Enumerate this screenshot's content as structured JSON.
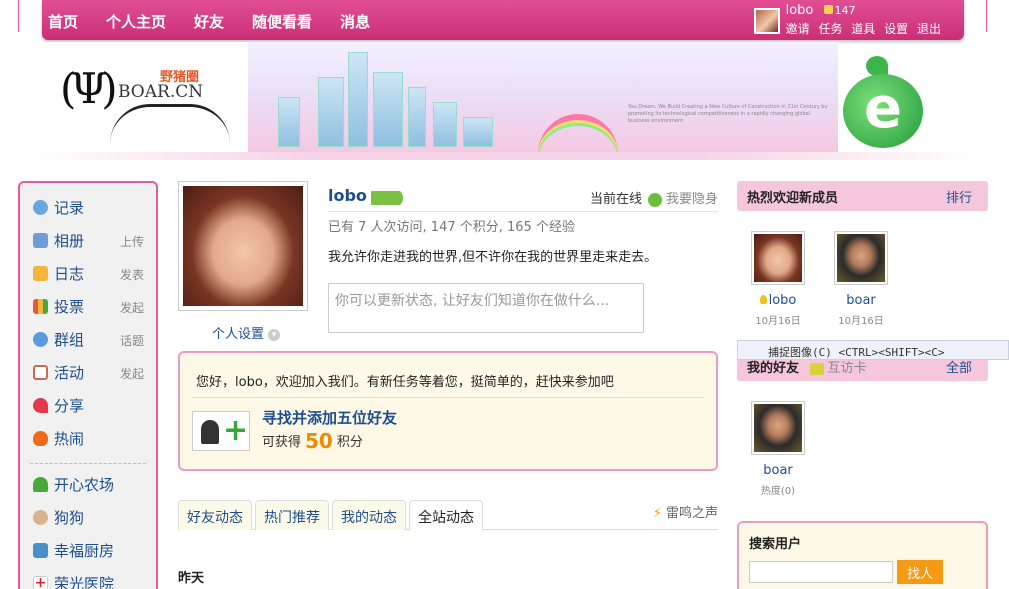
{
  "nav": {
    "items": [
      "首页",
      "个人主页",
      "好友",
      "随便看看",
      "消息"
    ]
  },
  "user": {
    "name": "lobo",
    "points": "147",
    "links": [
      "邀请",
      "任务",
      "道具",
      "设置",
      "退出"
    ]
  },
  "banner": {
    "logo_cn": "野猪圈",
    "logo_en": "BOAR.CN",
    "slogan": "You Dream, We Build  Creating a New Culture of Construction in 21st Century  by promoting its technological competitiveness in a rapidly changing global business environment"
  },
  "sidebar": {
    "items": [
      {
        "label": "记录",
        "action": "",
        "icon": "note-icon",
        "color": "#6aa7e0"
      },
      {
        "label": "相册",
        "action": "上传",
        "icon": "photo-icon",
        "color": "#6f9bd6"
      },
      {
        "label": "日志",
        "action": "发表",
        "icon": "blog-icon",
        "color": "#f2b63a"
      },
      {
        "label": "投票",
        "action": "发起",
        "icon": "poll-icon",
        "color": "#e55a3a"
      },
      {
        "label": "群组",
        "action": "话题",
        "icon": "group-icon",
        "color": "#5a9be0"
      },
      {
        "label": "活动",
        "action": "发起",
        "icon": "calendar-icon",
        "color": "#c86a5a"
      },
      {
        "label": "分享",
        "action": "",
        "icon": "heart-icon",
        "color": "#e23a4a"
      },
      {
        "label": "热闹",
        "action": "",
        "icon": "fire-icon",
        "color": "#f06a1a"
      }
    ],
    "apps": [
      {
        "label": "开心农场",
        "icon": "sprout-icon",
        "color": "#4aa83a"
      },
      {
        "label": "狗狗",
        "icon": "dog-icon",
        "color": "#d9b38c"
      },
      {
        "label": "幸福厨房",
        "icon": "kitchen-icon",
        "color": "#4a90c8"
      },
      {
        "label": "荣光医院",
        "icon": "hospital-icon",
        "color": "#e02020"
      }
    ]
  },
  "profile": {
    "name": "lobo",
    "online_label": "当前在线",
    "hide_label": "我要隐身",
    "stats": "已有  7 人次访问, 147 个积分, 165 个经验",
    "motto": "我允许你走进我的世界,但不许你在我的世界里走来走去。",
    "status_placeholder": "你可以更新状态, 让好友们知道你在做什么...",
    "settings_label": "个人设置"
  },
  "task": {
    "welcome": "您好，lobo，欢迎加入我们。有新任务等着您，挺简单的，赶快来参加吧",
    "title": "寻找并添加五位好友",
    "gain_prefix": "可获得",
    "gain_value": "50",
    "gain_suffix": "积分"
  },
  "tabs": {
    "items": [
      "好友动态",
      "热门推荐",
      "我的动态",
      "全站动态"
    ],
    "active": 3,
    "thunder": "雷鸣之声"
  },
  "feed": {
    "section": "昨天"
  },
  "new_members": {
    "title": "热烈欢迎新成员",
    "more": "排行",
    "members": [
      {
        "name": "lobo",
        "date": "10月16日"
      },
      {
        "name": "boar",
        "date": "10月16日"
      }
    ]
  },
  "capture_tip": "捕捉图像(C)   <CTRL><SHIFT><C>",
  "my_friends": {
    "title": "我的好友",
    "visit": "互访卡",
    "more": "全部",
    "friends": [
      {
        "name": "boar",
        "heat": "热度(0)"
      }
    ]
  },
  "search": {
    "label": "搜索用户",
    "button": "找人",
    "value": ""
  }
}
